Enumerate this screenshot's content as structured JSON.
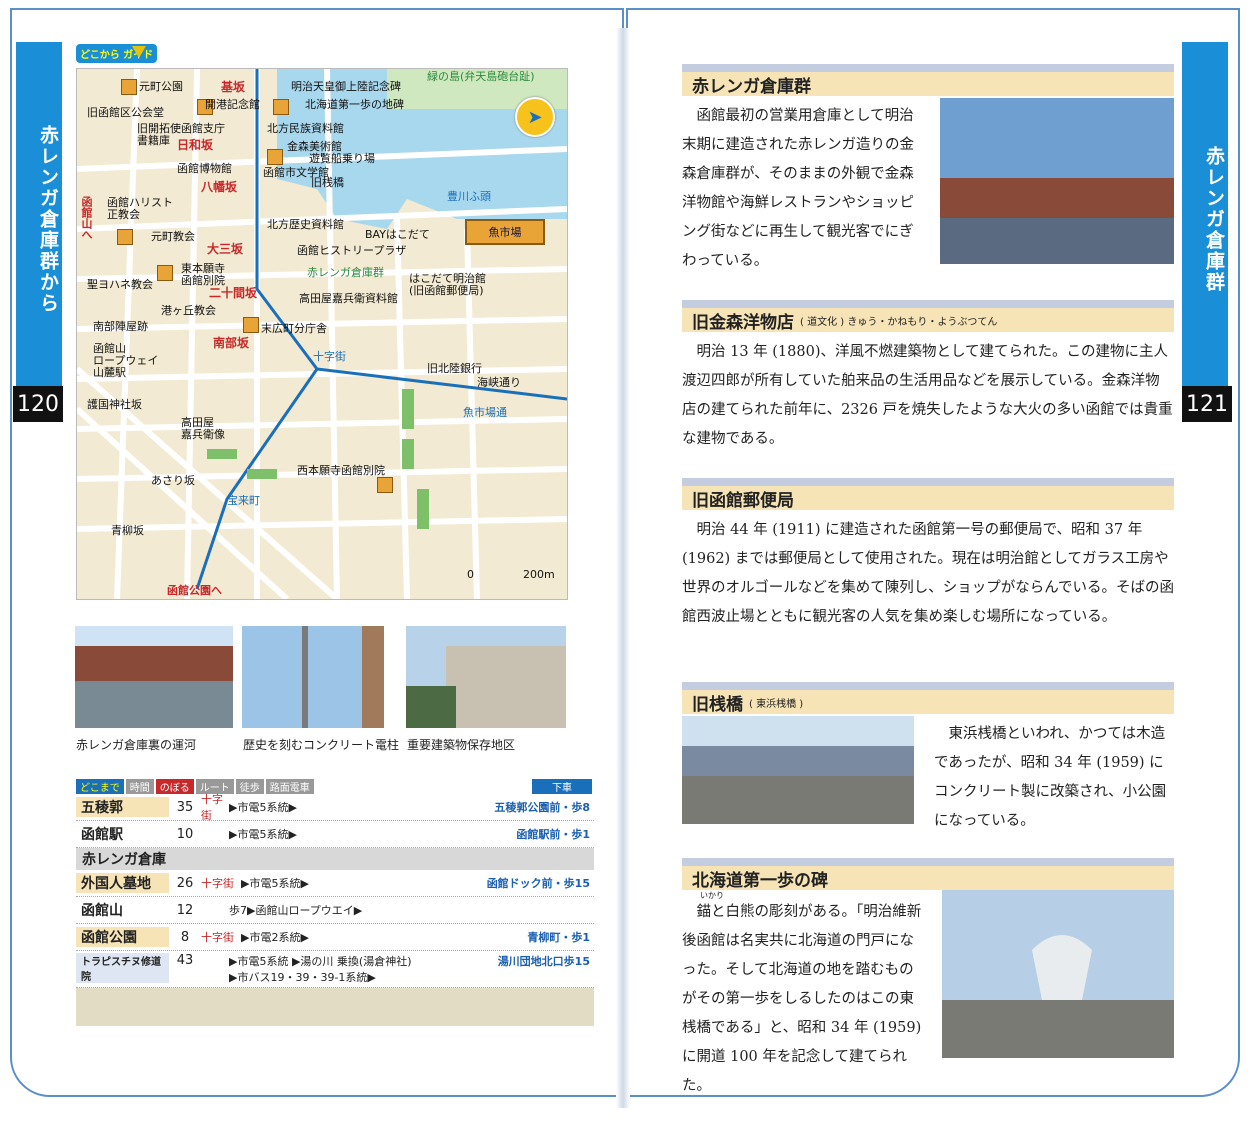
{
  "tabs": {
    "left": "赤レンガ倉庫群から",
    "right": "赤レンガ倉庫群"
  },
  "page_numbers": {
    "left": "120",
    "right": "121"
  },
  "map": {
    "guide_label": "どこから\nガイド",
    "labels": {
      "motomachi_park": "元町公園",
      "motozaka": "基坂",
      "meiji_tenno": "明治天皇御上陸記念碑",
      "hokkaido_first_step": "北海道第一歩の地碑",
      "midori_island": "緑の島(弁天島砲台趾)",
      "old_public_hall": "旧函館区公会堂",
      "kaiko_memorial": "開港記念館",
      "old_pioneer_office": "旧開拓使函館支庁\n書籍庫",
      "suehiro_town_v": "末広町",
      "northern_peoples": "北方民族資料館",
      "hiyorizaka": "日和坂",
      "hakodate_museum": "函館博物館",
      "kanemori_art": "金森美術館",
      "pleasure_boat": "遊覧船乗り場",
      "literature": "函館市文学館",
      "old_pier": "旧桟橋",
      "hachimanzaka": "八幡坂",
      "toyokawa_pier": "豊川ふ頭",
      "harist": "函館ハリスト\n正教会",
      "hakodate_yama_to": "函館山へ",
      "northern_history": "北方歴史資料館",
      "bay_hakodate": "BAYはこだて",
      "fish_market": "魚市場",
      "motomachi_church": "元町教会",
      "daisanzaka": "大三坂",
      "history_plaza": "函館ヒストリープラザ",
      "higashi_honganji": "東本願寺\n函館別院",
      "red_brick": "赤レンガ倉庫群",
      "meijikan": "はこだて明治館\n(旧函館郵便局)",
      "st_johannes": "聖ヨハネ教会",
      "nijukkenzaka": "二十間坂",
      "takadaya_archive": "高田屋嘉兵衛資料館",
      "minatogaoka": "港ヶ丘教会",
      "minamibe": "南部坂",
      "minamibu_jinya": "南部陣屋跡",
      "suehiro_branch": "末広町分庁舎",
      "jujigai": "十字街",
      "hakodateyama": "函館山\nロープウェイ\n山麓駅",
      "old_hokuriku_bank": "旧北陸銀行",
      "kaikyo_street": "海峡通り",
      "gokoku_shrine": "護国神社坂",
      "uoichiba_street": "魚市場通",
      "takadaya_statue": "高田屋\n嘉兵衛像",
      "nishi_honganji": "西本願寺函館別院",
      "asarizaka": "あさり坂",
      "horaicho": "宝来町",
      "aoyagizaka": "青柳坂",
      "scale_zero": "0",
      "scale_200m": "200m",
      "hakodate_park_to": "函館公園へ"
    }
  },
  "photos": [
    {
      "caption": "赤レンガ倉庫裏の運河"
    },
    {
      "caption": "歴史を刻むコンクリート電柱"
    },
    {
      "caption": "重要建築物保存地区"
    }
  ],
  "route": {
    "header": {
      "where": "どこまで",
      "time": "時間",
      "noboru": "のぼる",
      "route": "ルート",
      "walk": "徒歩",
      "tram": "路面電車",
      "getoff": "下車"
    },
    "rows": [
      {
        "dest": "五稜郭",
        "min": "35",
        "transfer": "十字街",
        "route": "▶市電5系統▶",
        "stop": "五稜郭公園前・歩8"
      },
      {
        "dest": "函館駅",
        "min": "10",
        "transfer": "",
        "route": "▶市電5系統▶",
        "stop": "函館駅前・歩1"
      }
    ],
    "section": "赤レンガ倉庫",
    "rows2": [
      {
        "dest": "外国人墓地",
        "min": "26",
        "transfer": "十字街",
        "route": "▶市電5系統▶",
        "stop": "函館ドック前・歩15"
      },
      {
        "dest": "函館山",
        "min": "12",
        "transfer": "",
        "route": "歩7▶函館山ロープウエイ▶",
        "stop": ""
      },
      {
        "dest": "函館公園",
        "min": "8",
        "transfer": "十字街",
        "route": "▶市電2系統▶",
        "stop": "青柳町・歩1"
      },
      {
        "dest": "トラピスチヌ修道院",
        "min": "43",
        "transfer": "",
        "route": "▶市電5系統 ▶湯の川 乗換(湯倉神社)",
        "route2": "▶市バス19・39・39-1系統▶",
        "stop": "湯川団地北口歩15"
      }
    ]
  },
  "articles": [
    {
      "title": "赤レンガ倉庫群",
      "sub": "",
      "body": "函館最初の営業用倉庫として明治末期に建造された赤レンガ造りの金森倉庫群が、そのままの外観で金森洋物館や海鮮レストランやショッピング街などに再生して観光客でにぎわっている。"
    },
    {
      "title": "旧金森洋物店",
      "sub": "( 道文化 ) きゅう・かねもり・ようぶつてん",
      "body": "明治 13 年 (1880)、洋風不燃建築物として建てられた。この建物に主人渡辺四郎が所有していた舶来品の生活用品などを展示している。金森洋物店の建てられた前年に、2326 戸を焼失したような大火の多い函館では貴重な建物である。"
    },
    {
      "title": "旧函館郵便局",
      "sub": "",
      "body": "明治 44 年 (1911) に建造された函館第一号の郵便局で、昭和 37 年 (1962) までは郵便局として使用された。現在は明治館としてガラス工房や世界のオルゴールなどを集めて陳列し、ショップがならんでいる。そばの函館西波止場とともに観光客の人気を集め楽しむ場所になっている。"
    },
    {
      "title": "旧桟橋",
      "sub": "( 東浜桟橋 )",
      "body": "東浜桟橋といわれ、かつては木造であったが、昭和 34 年 (1959) にコンクリート製に改築され、小公園になっている。"
    },
    {
      "title": "北海道第一歩の碑",
      "sub": "",
      "body": "錨と白熊の彫刻がある。「明治維新後函館は名実共に北海道の門戸になった。そして北海道の地を踏むものがその第一歩をしるしたのはこの東桟橋である」と、昭和 34 年 (1959) に開道 100 年を記念して建てられた。",
      "ruby": "いかり"
    }
  ]
}
